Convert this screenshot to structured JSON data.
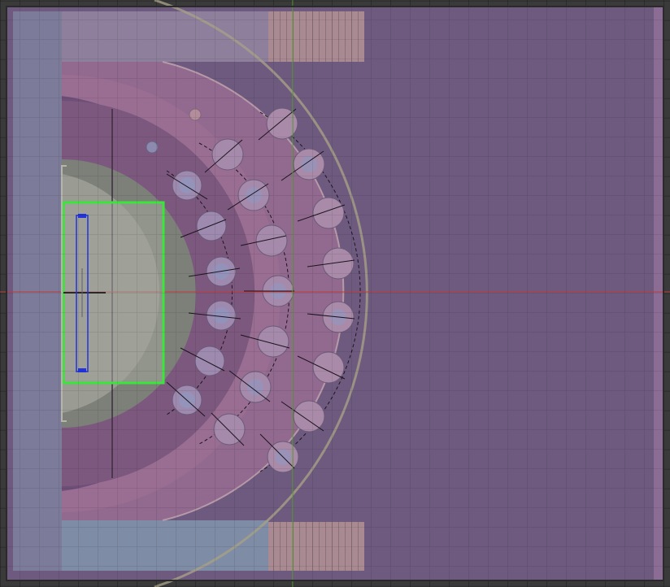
{
  "viewport": {
    "colors": {
      "background": "#3a3a3a",
      "panel": "#6d5a7e",
      "panel_light": "#8a6a93",
      "blue_panel": "#7a7e9a",
      "tan_panel": "#a98a92",
      "selection": "#39e639",
      "selection_inner": "#2233dd",
      "axis_x": "#c23a3a",
      "axis_y": "#55a82b"
    },
    "hole_rows": {
      "inner": 6,
      "middle": 7,
      "outer": 8
    }
  }
}
